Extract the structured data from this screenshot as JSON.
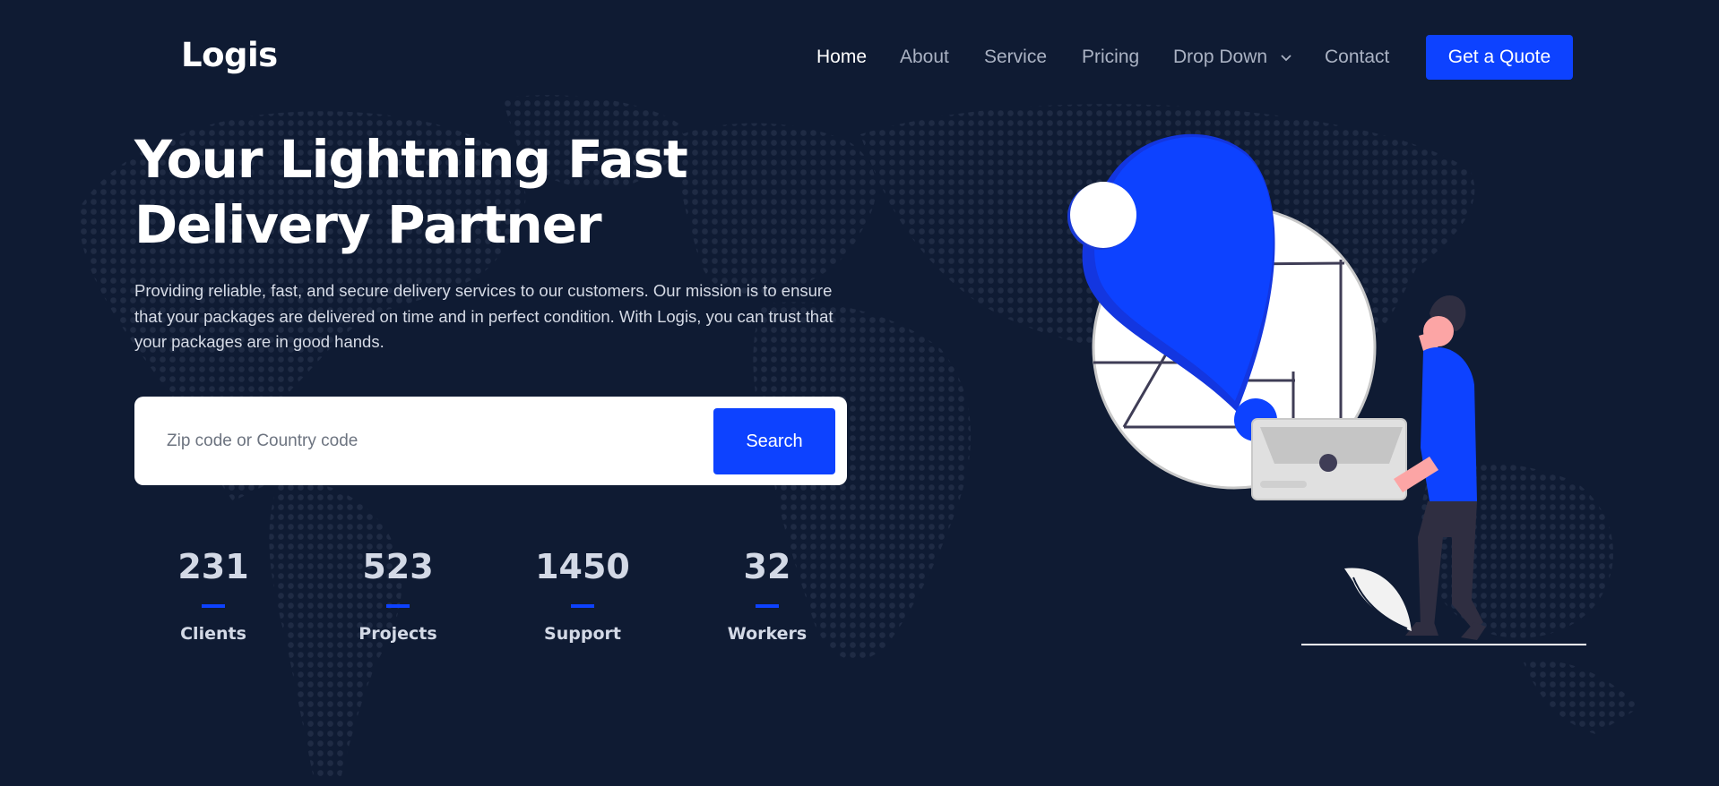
{
  "header": {
    "logo": "Logis",
    "nav": [
      {
        "label": "Home",
        "active": true
      },
      {
        "label": "About",
        "active": false
      },
      {
        "label": "Service",
        "active": false
      },
      {
        "label": "Pricing",
        "active": false
      },
      {
        "label": "Drop Down",
        "active": false,
        "dropdown": true
      },
      {
        "label": "Contact",
        "active": false
      }
    ],
    "cta_label": "Get a Quote"
  },
  "hero": {
    "title_line1": "Your Lightning Fast",
    "title_line2": "Delivery Partner",
    "description": "Providing reliable, fast, and secure delivery services to our customers. Our mission is to ensure that your packages are delivered on time and in perfect condition. With Logis, you can trust that your packages are in good hands.",
    "search": {
      "placeholder": "Zip code or Country code",
      "value": "",
      "button_label": "Search"
    }
  },
  "stats": [
    {
      "value": "231",
      "label": "Clients"
    },
    {
      "value": "523",
      "label": "Projects"
    },
    {
      "value": "1450",
      "label": "Support"
    },
    {
      "value": "32",
      "label": "Workers"
    }
  ],
  "colors": {
    "background": "#0f1b33",
    "accent": "#0d42ff",
    "text": "#ffffff",
    "muted_text": "#aab2c3"
  }
}
